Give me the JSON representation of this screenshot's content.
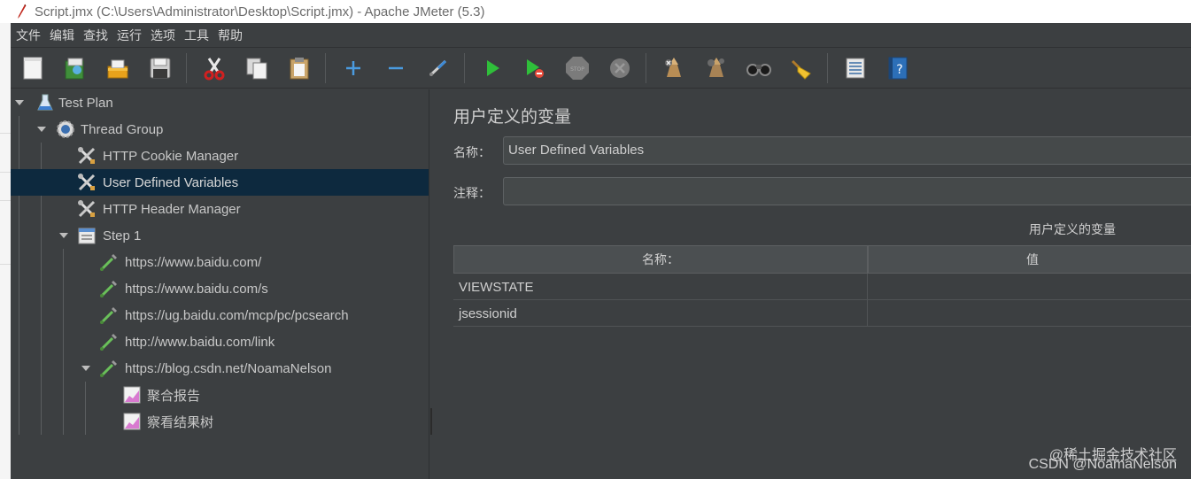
{
  "window": {
    "title": "Script.jmx (C:\\Users\\Administrator\\Desktop\\Script.jmx) - Apache JMeter (5.3)"
  },
  "menu": [
    "文件",
    "编辑",
    "查找",
    "运行",
    "选项",
    "工具",
    "帮助"
  ],
  "toolbar": {
    "buttons": [
      "new-icon",
      "templates-icon",
      "open-icon",
      "save-icon",
      "cut-icon",
      "copy-icon",
      "paste-icon",
      "expand-icon",
      "collapse-icon",
      "toggle-icon",
      "start-icon",
      "start-no-pauses-icon",
      "stop-icon",
      "shutdown-icon",
      "clear-icon",
      "clear-all-icon",
      "search-icon",
      "reset-search-icon",
      "function-helper-icon",
      "help-icon"
    ]
  },
  "tree": {
    "items": [
      {
        "label": "Test Plan",
        "icon": "flask-icon",
        "expanded": true
      },
      {
        "label": "Thread Group",
        "icon": "gear-icon",
        "expanded": true
      },
      {
        "label": "HTTP Cookie Manager",
        "icon": "tools-icon"
      },
      {
        "label": "User Defined Variables",
        "icon": "tools-icon",
        "selected": true
      },
      {
        "label": "HTTP Header Manager",
        "icon": "tools-icon"
      },
      {
        "label": "Step 1",
        "icon": "controller-icon",
        "expanded": true
      },
      {
        "label": "https://www.baidu.com/",
        "icon": "pipette-icon"
      },
      {
        "label": "https://www.baidu.com/s",
        "icon": "pipette-icon"
      },
      {
        "label": "https://ug.baidu.com/mcp/pc/pcsearch",
        "icon": "pipette-icon"
      },
      {
        "label": "http://www.baidu.com/link",
        "icon": "pipette-icon"
      },
      {
        "label": "https://blog.csdn.net/NoamaNelson",
        "icon": "pipette-icon",
        "expanded": true
      },
      {
        "label": "聚合报告",
        "icon": "chart-icon"
      },
      {
        "label": "察看结果树",
        "icon": "chart-icon"
      }
    ]
  },
  "panel": {
    "title": "用户定义的变量",
    "name_label": "名称：",
    "name_value": "User Defined Variables",
    "comment_label": "注释：",
    "comment_value": "",
    "table_caption": "用户定义的变量",
    "columns": [
      "名称：",
      "值"
    ],
    "rows": [
      {
        "name": "VIEWSTATE",
        "value": ""
      },
      {
        "name": "jsessionid",
        "value": ""
      }
    ]
  },
  "watermark": {
    "line1": "@稀土掘金技术社区",
    "line2": "CSDN @NoamaNelson"
  },
  "colors": {
    "background": "#3c3f41",
    "selection": "#0d293e",
    "text": "#c8c8c8"
  }
}
